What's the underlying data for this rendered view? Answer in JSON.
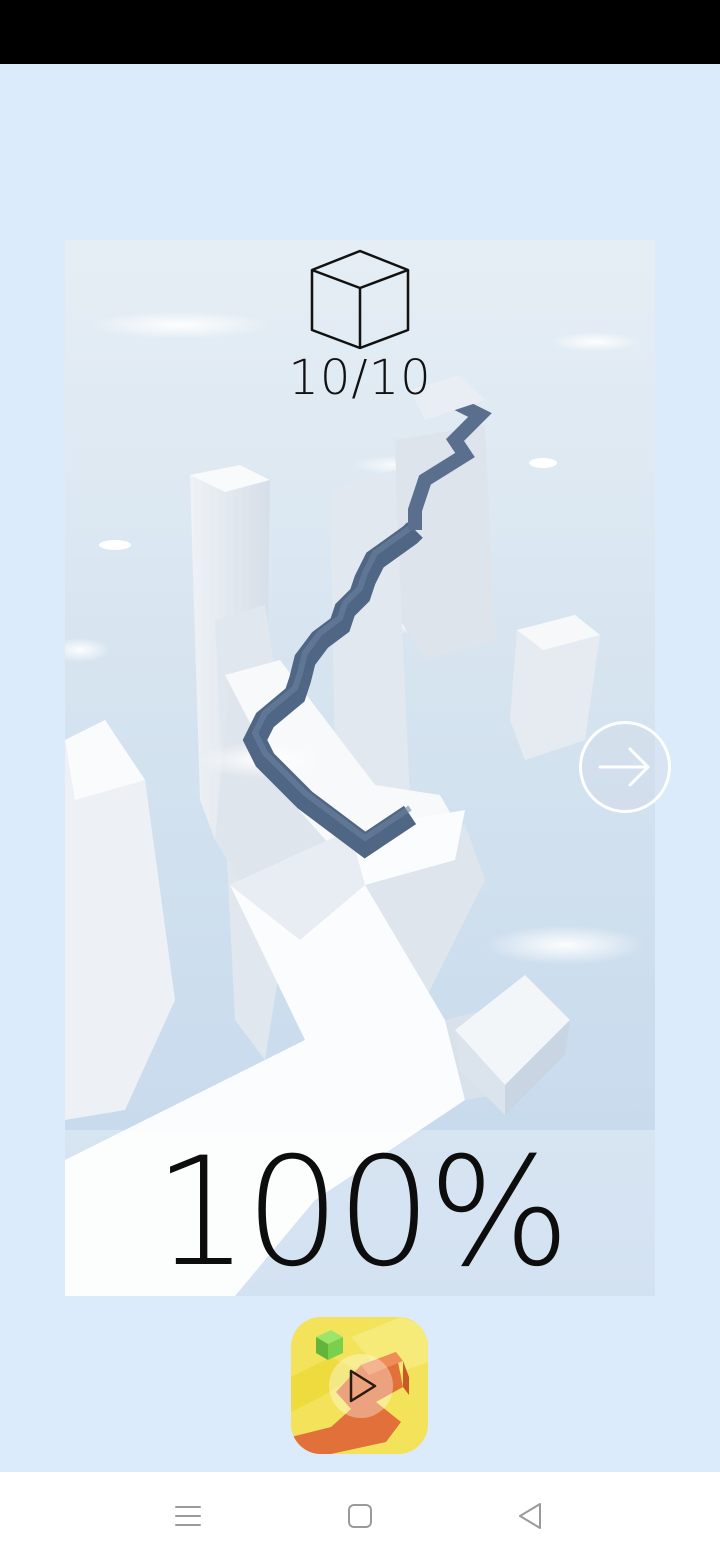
{
  "hud": {
    "gem_icon": "cube-outline-icon",
    "gems_collected": "10/10",
    "progress_percent": "100%",
    "progress_value": 100
  },
  "controls": {
    "next_icon": "arrow-right-circle-icon",
    "app_icon": "dancing-line-app-icon",
    "play_icon": "play-triangle-icon"
  },
  "navigation": {
    "menu_icon": "menu-lines-icon",
    "home_icon": "home-square-icon",
    "back_icon": "back-triangle-icon"
  },
  "colors": {
    "background": "#dcebfb",
    "path_line": "#4f6684",
    "text": "#0d0d0d",
    "app_icon_yellow": "#f3e35a",
    "app_icon_orange": "#e2703a",
    "app_icon_green": "#7ad04b"
  }
}
